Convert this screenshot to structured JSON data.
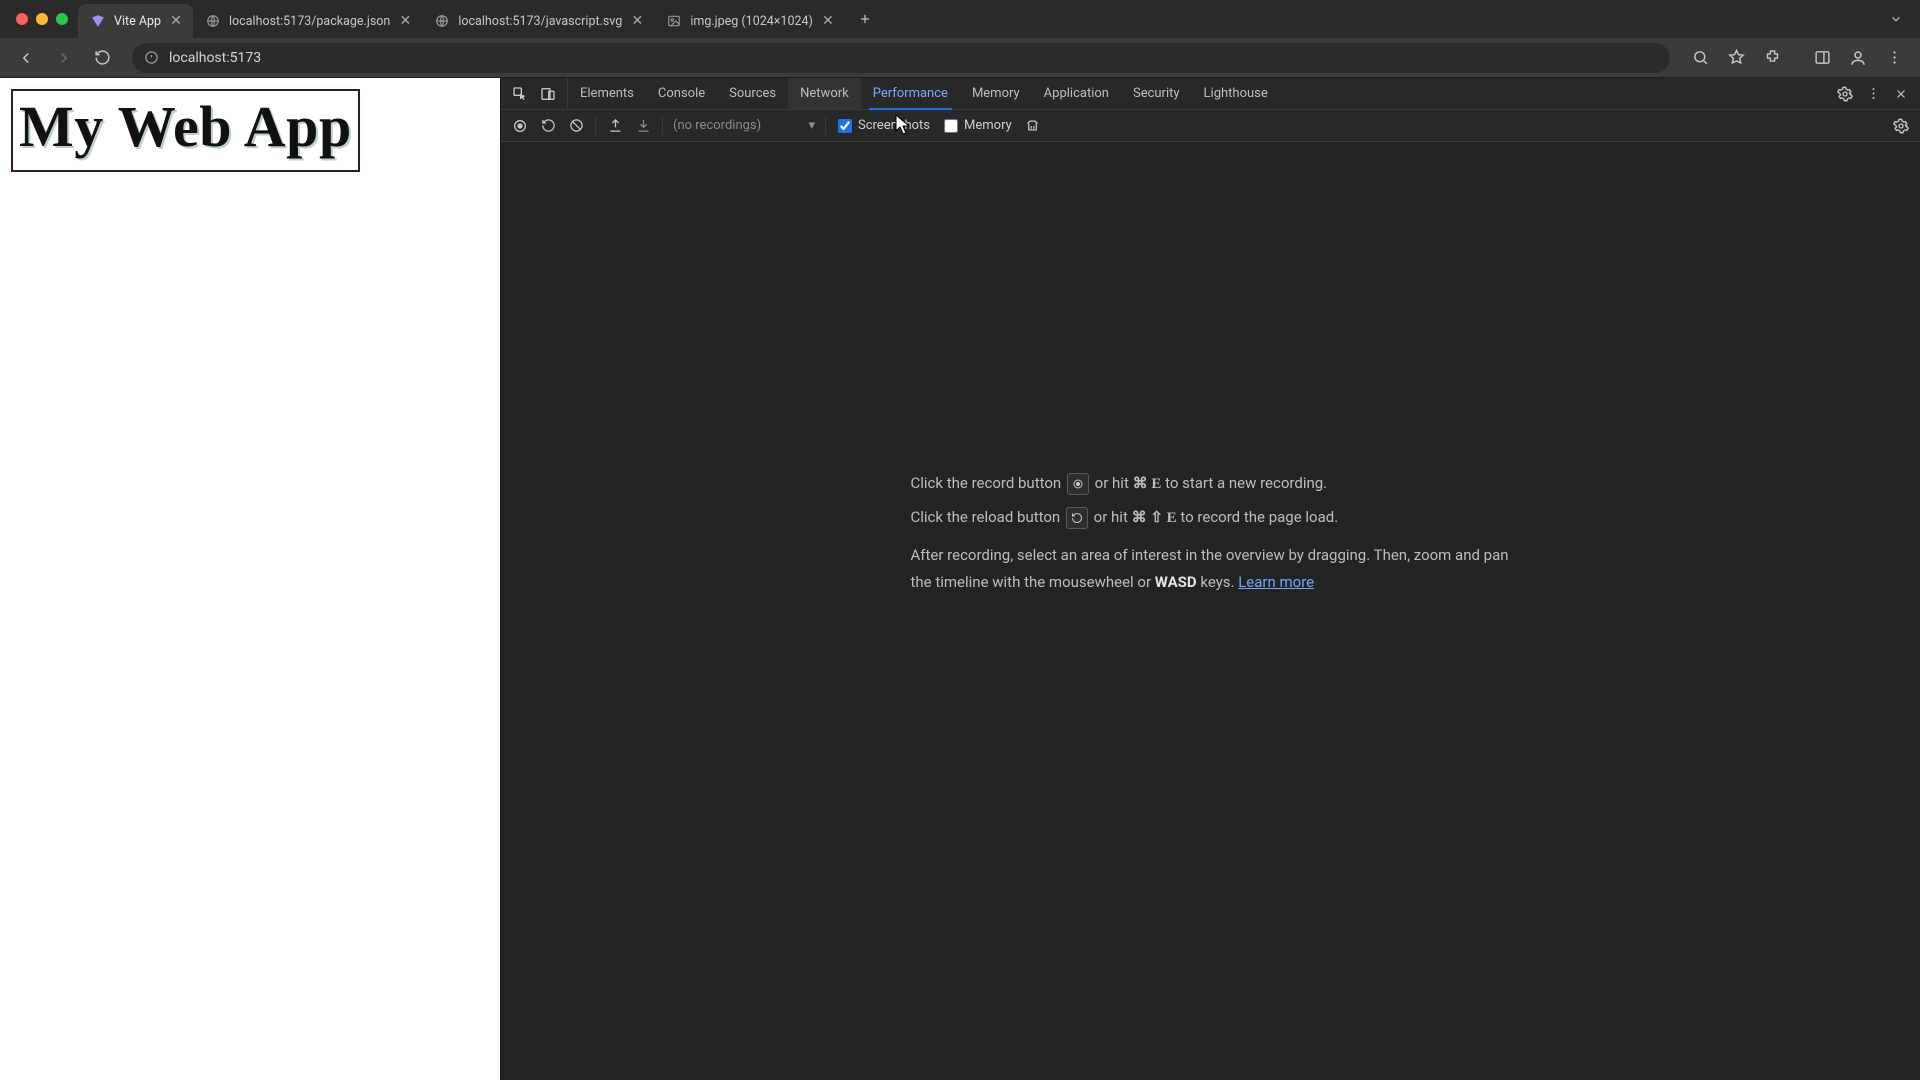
{
  "tabs": [
    {
      "title": "Vite App",
      "active": true
    },
    {
      "title": "localhost:5173/package.json",
      "active": false
    },
    {
      "title": "localhost:5173/javascript.svg",
      "active": false
    },
    {
      "title": "img.jpeg (1024×1024)",
      "active": false
    }
  ],
  "addressbar": {
    "url": "localhost:5173"
  },
  "page": {
    "heading": "My Web App"
  },
  "devtools": {
    "panels": [
      "Elements",
      "Console",
      "Sources",
      "Network",
      "Performance",
      "Memory",
      "Application",
      "Security",
      "Lighthouse"
    ],
    "active_panel": "Performance",
    "hover_panel": "Network",
    "toolbar": {
      "recordings_placeholder": "(no recordings)",
      "screenshots_label": "Screenshots",
      "screenshots_checked": true,
      "memory_label": "Memory",
      "memory_checked": false
    },
    "empty": {
      "line1_a": "Click the record button ",
      "line1_b": " or hit ",
      "line1_keys": "⌘ E",
      "line1_c": " to start a new recording.",
      "line2_a": "Click the reload button ",
      "line2_b": " or hit ",
      "line2_keys": "⌘ ⇧ E",
      "line2_c": " to record the page load.",
      "line3_a": "After recording, select an area of interest in the overview by dragging. Then, zoom and pan the timeline with the mousewheel or ",
      "line3_wasd": "WASD",
      "line3_b": " keys. ",
      "learn_more": "Learn more"
    }
  }
}
